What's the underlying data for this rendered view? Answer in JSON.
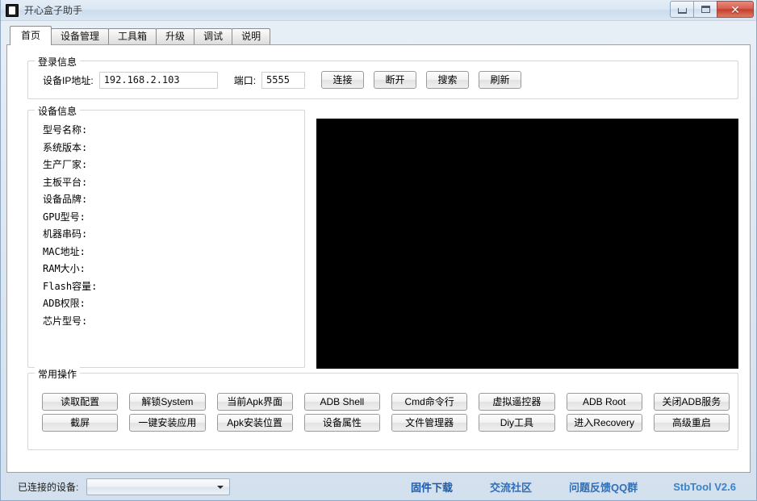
{
  "window": {
    "title": "开心盒子助手",
    "icon": "app-icon",
    "controls": {
      "minimize": "minimize-icon",
      "maximize": "maximize-icon",
      "close": "✕"
    }
  },
  "tabs": [
    {
      "label": "首页",
      "active": true
    },
    {
      "label": "设备管理",
      "active": false
    },
    {
      "label": "工具箱",
      "active": false
    },
    {
      "label": "升级",
      "active": false
    },
    {
      "label": "调试",
      "active": false
    },
    {
      "label": "说明",
      "active": false
    }
  ],
  "login": {
    "group_title": "登录信息",
    "ip_label": "设备IP地址:",
    "ip_value": "192.168.2.103",
    "ip_placeholder": "",
    "port_label": "端口:",
    "port_value": "5555",
    "port_placeholder": "",
    "buttons": [
      {
        "label": "连接"
      },
      {
        "label": "断开"
      },
      {
        "label": "搜索"
      },
      {
        "label": "刷新"
      }
    ]
  },
  "device_info": {
    "group_title": "设备信息",
    "fields": [
      {
        "label": "型号名称:",
        "value": ""
      },
      {
        "label": "系统版本:",
        "value": ""
      },
      {
        "label": "生产厂家:",
        "value": ""
      },
      {
        "label": "主板平台:",
        "value": ""
      },
      {
        "label": "设备品牌:",
        "value": ""
      },
      {
        "label": "GPU型号:",
        "value": ""
      },
      {
        "label": "机器串码:",
        "value": ""
      },
      {
        "label": "MAC地址:",
        "value": ""
      },
      {
        "label": "RAM大小:",
        "value": ""
      },
      {
        "label": "Flash容量:",
        "value": ""
      },
      {
        "label": "ADB权限:",
        "value": ""
      },
      {
        "label": "芯片型号:",
        "value": ""
      }
    ]
  },
  "preview": {
    "name": "screen-preview",
    "background": "#000000"
  },
  "operations": {
    "group_title": "常用操作",
    "buttons": [
      {
        "label": "读取配置"
      },
      {
        "label": "解锁System"
      },
      {
        "label": "当前Apk界面"
      },
      {
        "label": "ADB Shell"
      },
      {
        "label": "Cmd命令行"
      },
      {
        "label": "虚拟遥控器"
      },
      {
        "label": "ADB  Root"
      },
      {
        "label": "关闭ADB服务"
      },
      {
        "label": "截屏"
      },
      {
        "label": "一键安装应用"
      },
      {
        "label": "Apk安装位置"
      },
      {
        "label": "设备属性"
      },
      {
        "label": "文件管理器"
      },
      {
        "label": "Diy工具"
      },
      {
        "label": "进入Recovery"
      },
      {
        "label": "高级重启"
      }
    ]
  },
  "statusbar": {
    "connected_label": "已连接的设备:",
    "connected_value": "",
    "links": [
      {
        "label": "固件下载",
        "color": "#1b5ba8"
      },
      {
        "label": "交流社区",
        "color": "#2f6fb8"
      },
      {
        "label": "问题反馈QQ群",
        "color": "#2f6fb8"
      },
      {
        "label": "StbTool V2.6",
        "color": "#3a82c8"
      }
    ]
  },
  "colors": {
    "accent_link": "#2f6fb8",
    "window_frame": "#d3e0ee",
    "preview_bg": "#000000"
  }
}
